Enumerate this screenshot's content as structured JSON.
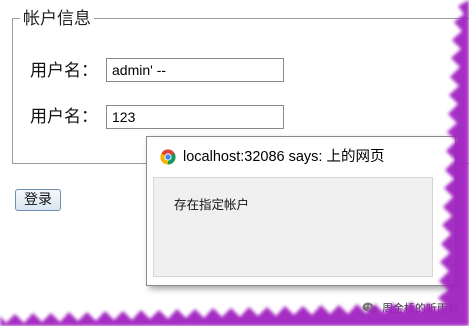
{
  "form": {
    "legend": "帐户信息",
    "username_label": "用户名：",
    "username_value": "admin' --",
    "password_label": "用户名：",
    "password_value": "123",
    "login_button_label": "登录"
  },
  "dialog": {
    "title": "localhost:32086 says: 上的网页",
    "message": "存在指定帐户",
    "icon": "chrome-icon"
  },
  "watermark": {
    "text": "周金桥的听雨轩",
    "icon": "wechat-icon"
  },
  "colors": {
    "torn_edge_shadow": "#a020c0",
    "dialog_body_bg": "#f0f0f0",
    "button_border": "#6f8fb0"
  }
}
